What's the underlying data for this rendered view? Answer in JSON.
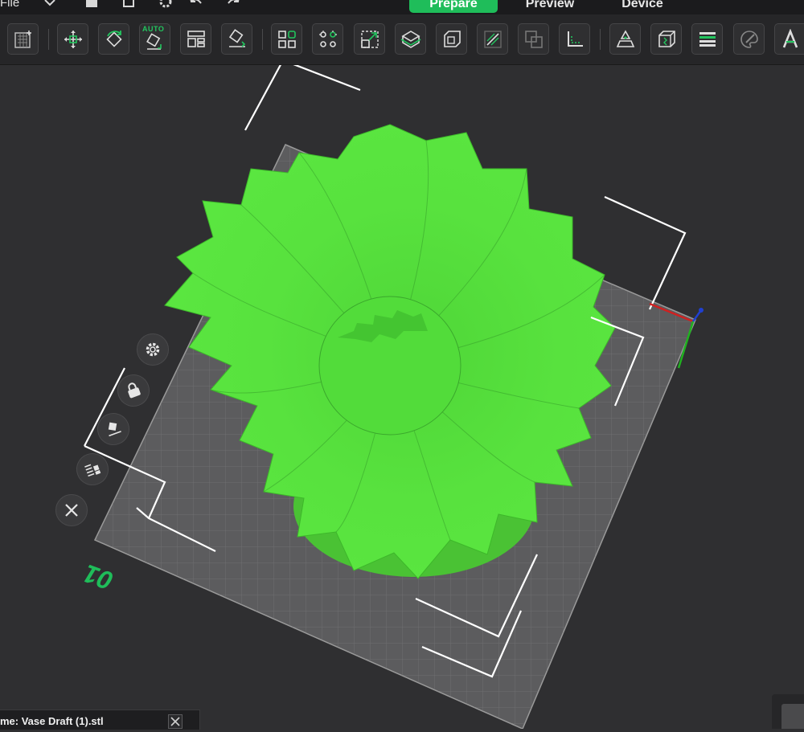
{
  "menu": {
    "file_label": "File",
    "icons": [
      "chevron-down-icon",
      "save-icon",
      "new-file-icon",
      "settings-icon",
      "undo-icon",
      "redo-icon"
    ]
  },
  "tabs": [
    {
      "label": "Prepare",
      "active": true
    },
    {
      "label": "Preview",
      "active": false
    },
    {
      "label": "Device",
      "active": false
    }
  ],
  "toolbar": {
    "auto_label": "AUTO",
    "buttons": [
      "add-plate-icon",
      "move-icon",
      "rotate-icon",
      "auto-orient-icon",
      "arrange-icon",
      "lay-on-face-icon",
      "split-objects-icon",
      "split-parts-icon",
      "scale-icon",
      "cut-icon",
      "hollow-icon",
      "support-paint-icon",
      "boolean-icon",
      "measure-icon",
      "seam-icon",
      "emboss-icon",
      "variable-layer-icon",
      "color-paint-icon",
      "text-icon"
    ]
  },
  "viewport": {
    "plate_number": "01",
    "side_buttons": [
      "settings-icon",
      "lock-icon",
      "auto-orient-icon",
      "layers-icon",
      "delete-icon"
    ]
  },
  "status": {
    "object_name": "me: Vase Draft (1).stl"
  },
  "colors": {
    "accent": "#1fbd5a",
    "model": "#55e23c",
    "plate_edge": "#9a9a9a",
    "background": "#2f2f31"
  }
}
